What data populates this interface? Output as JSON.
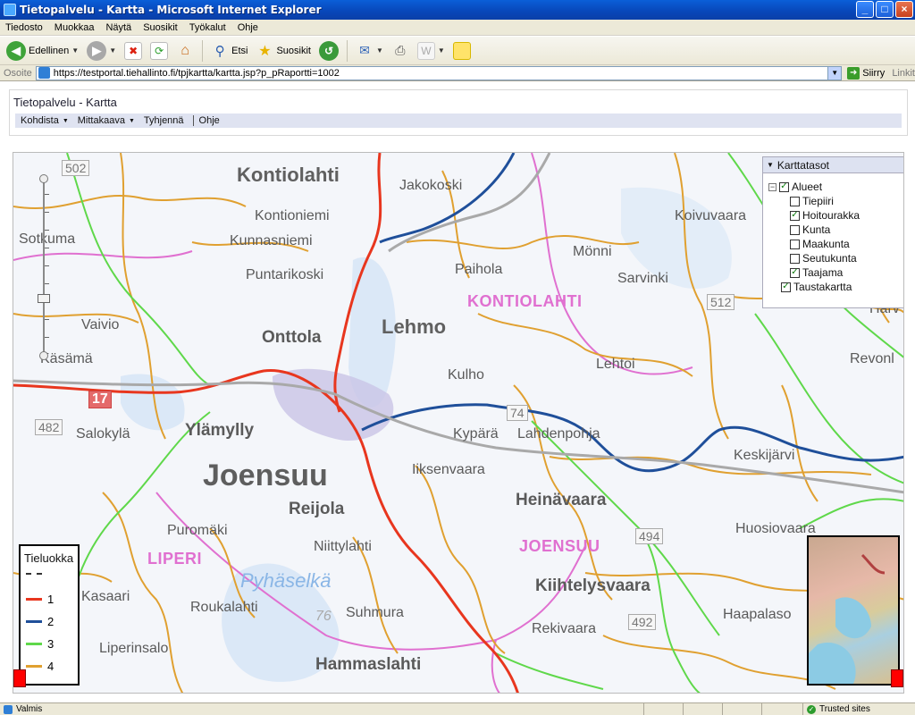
{
  "window": {
    "title": "Tietopalvelu - Kartta - Microsoft Internet Explorer",
    "minimize": "_",
    "maximize": "□",
    "close": "×"
  },
  "menubar": [
    "Tiedosto",
    "Muokkaa",
    "Näytä",
    "Suosikit",
    "Työkalut",
    "Ohje"
  ],
  "toolbar": {
    "back_label": "Edellinen",
    "search_label": "Etsi",
    "favorites_label": "Suosikit"
  },
  "address": {
    "label": "Osoite",
    "url": "https://testportal.tiehallinto.fi/tpjkartta/kartta.jsp?p_pRaportti=1002",
    "go_label": "Siirry",
    "links_label": "Linkit"
  },
  "app": {
    "title": "Tietopalvelu - Kartta",
    "menu": [
      {
        "label": "Kohdista",
        "dropdown": true
      },
      {
        "label": "Mittakaava",
        "dropdown": true
      },
      {
        "label": "Tyhjennä",
        "dropdown": false
      },
      {
        "label": "Ohje",
        "dropdown": false
      }
    ]
  },
  "map": {
    "places": [
      {
        "text": "Kontiolahti",
        "cls": "big"
      },
      {
        "text": "Jakokoski",
        "cls": "norm"
      },
      {
        "text": "Koivuvaara",
        "cls": "norm"
      },
      {
        "text": "Kontioniemi",
        "cls": "norm"
      },
      {
        "text": "Kunnasniemi",
        "cls": "norm"
      },
      {
        "text": "Sotkuma",
        "cls": "norm"
      },
      {
        "text": "Mönni",
        "cls": "norm"
      },
      {
        "text": "Puntarikoski",
        "cls": "norm"
      },
      {
        "text": "Paihola",
        "cls": "norm"
      },
      {
        "text": "Sarvinki",
        "cls": "norm"
      },
      {
        "text": "KONTIOLAHTI",
        "cls": "muni"
      },
      {
        "text": "Vaivio",
        "cls": "norm"
      },
      {
        "text": "Lehmo",
        "cls": "big"
      },
      {
        "text": "Onttola",
        "cls": "med"
      },
      {
        "text": "Käsämä",
        "cls": "norm"
      },
      {
        "text": "Kulho",
        "cls": "norm"
      },
      {
        "text": "Lehtoi",
        "cls": "norm"
      },
      {
        "text": "Revonl",
        "cls": "norm"
      },
      {
        "text": "Harv",
        "cls": "norm"
      },
      {
        "text": "Salokylä",
        "cls": "norm"
      },
      {
        "text": "Ylämylly",
        "cls": "med"
      },
      {
        "text": "Kypärä",
        "cls": "norm"
      },
      {
        "text": "Lahdenpohja",
        "cls": "norm"
      },
      {
        "text": "Keskijärvi",
        "cls": "norm"
      },
      {
        "text": "Joensuu",
        "cls": "huge"
      },
      {
        "text": "Iiksenvaara",
        "cls": "norm"
      },
      {
        "text": "Reijola",
        "cls": "med"
      },
      {
        "text": "Heinävaara",
        "cls": "med"
      },
      {
        "text": "Puromäki",
        "cls": "norm"
      },
      {
        "text": "Niittylahti",
        "cls": "norm"
      },
      {
        "text": "JOENSUU",
        "cls": "muni"
      },
      {
        "text": "Huosiovaara",
        "cls": "norm"
      },
      {
        "text": "LIPERI",
        "cls": "muni"
      },
      {
        "text": "Pyhäselkä",
        "cls": "lake"
      },
      {
        "text": "Kiihtelysvaara",
        "cls": "med"
      },
      {
        "text": "Kasaari",
        "cls": "norm"
      },
      {
        "text": "Roukalahti",
        "cls": "norm"
      },
      {
        "text": "Suhmura",
        "cls": "norm"
      },
      {
        "text": "Haapalaso",
        "cls": "norm"
      },
      {
        "text": "Liperinsalo",
        "cls": "norm"
      },
      {
        "text": "Rekivaara",
        "cls": "norm"
      },
      {
        "text": "Hammaslahti",
        "cls": "med"
      }
    ],
    "road_numbers": [
      {
        "text": "502",
        "red": false
      },
      {
        "text": "512",
        "red": false
      },
      {
        "text": "17",
        "red": true
      },
      {
        "text": "482",
        "red": false
      },
      {
        "text": "74",
        "red": false
      },
      {
        "text": "494",
        "red": false
      },
      {
        "text": "492",
        "red": false
      },
      {
        "text": "76",
        "red": false
      }
    ]
  },
  "layers": {
    "title": "Karttatasot",
    "items": [
      {
        "label": "Alueet",
        "checked": true,
        "level": 0,
        "expander": "⊟"
      },
      {
        "label": "Tiepiiri",
        "checked": false,
        "level": 1
      },
      {
        "label": "Hoitourakka",
        "checked": true,
        "level": 1
      },
      {
        "label": "Kunta",
        "checked": false,
        "level": 1
      },
      {
        "label": "Maakunta",
        "checked": false,
        "level": 1
      },
      {
        "label": "Seutukunta",
        "checked": false,
        "level": 1
      },
      {
        "label": "Taajama",
        "checked": true,
        "level": 1
      },
      {
        "label": "Taustakartta",
        "checked": true,
        "level": 0
      }
    ]
  },
  "legend": {
    "title": "Tieluokka",
    "items": [
      {
        "label": "",
        "color": "#333333",
        "dash": true
      },
      {
        "label": "1",
        "color": "#e8361e",
        "dash": false
      },
      {
        "label": "2",
        "color": "#1f4f9a",
        "dash": false
      },
      {
        "label": "3",
        "color": "#5fd84a",
        "dash": false
      },
      {
        "label": "4",
        "color": "#e0a030",
        "dash": false
      }
    ]
  },
  "status": {
    "text": "Valmis",
    "zone": "Trusted sites"
  },
  "colors": {
    "road_class_1": "#e8361e",
    "road_class_2": "#1f4f9a",
    "road_class_3": "#5fd84a",
    "road_class_4": "#e0a030",
    "municipality_border": "#e070d0"
  }
}
